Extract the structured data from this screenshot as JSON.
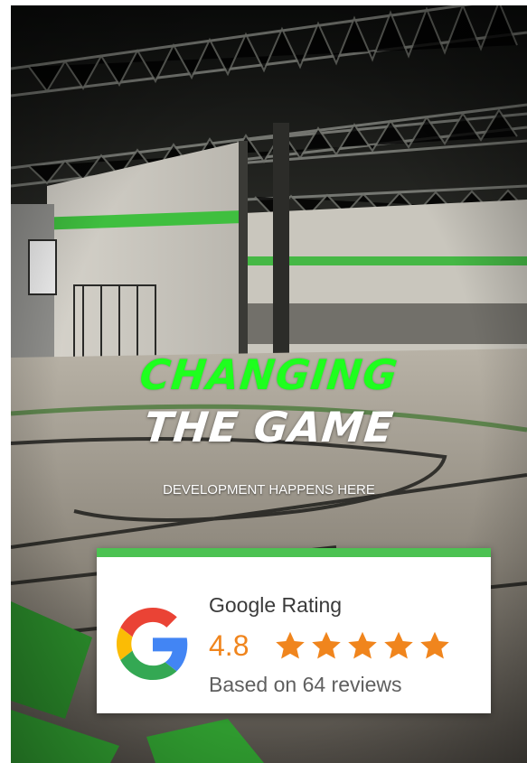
{
  "hero": {
    "headline_line1": "CHANGING",
    "headline_line2": "THE GAME",
    "tagline": "DEVELOPMENT HAPPENS HERE"
  },
  "rating_badge": {
    "logo_icon": "google-g-icon",
    "title": "Google Rating",
    "score": "4.8",
    "stars_filled": 5,
    "stars_total": 5,
    "reviews_text": "Based on 64 reviews",
    "colors": {
      "accent_bar": "#4cc252",
      "star": "#f0851d",
      "score": "#f0851d"
    }
  },
  "colors": {
    "headline_green": "#1eff1e",
    "headline_white": "#ffffff"
  }
}
